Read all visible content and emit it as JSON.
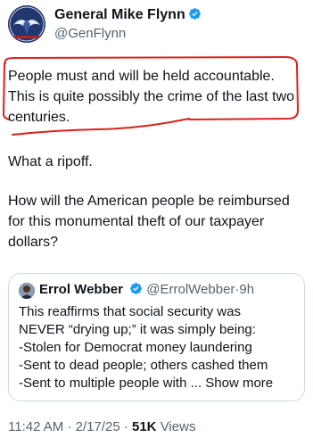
{
  "author": {
    "display_name": "General Mike Flynn",
    "handle": "@GenFlynn",
    "verified_icon": "verified-badge-icon"
  },
  "tweet": {
    "paragraph1": "People must and will be held accountable. This is quite possibly the crime of the last two centuries.",
    "paragraph2": "What a ripoff.",
    "paragraph3": "How will the American people be reimbursed for this monumental theft of our taxpayer dollars?"
  },
  "quote": {
    "display_name": "Errol Webber",
    "handle": "@ErrolWebber",
    "separator": "·",
    "time": "9h",
    "lines": [
      "This reaffirms that social security was",
      "NEVER “drying up;” it was simply being:",
      "-Stolen for Democrat money laundering",
      "-Sent to dead people; others cashed them",
      "-Sent to multiple people with ..."
    ],
    "show_more": "Show more"
  },
  "meta": {
    "time": "11:42 AM",
    "separator": "·",
    "date": "2/17/25",
    "views_count": "51K",
    "views_label": "Views"
  },
  "colors": {
    "highlight_red": "#d9231b",
    "verified_blue": "#1d9bf0",
    "secondary_text": "#536471"
  }
}
